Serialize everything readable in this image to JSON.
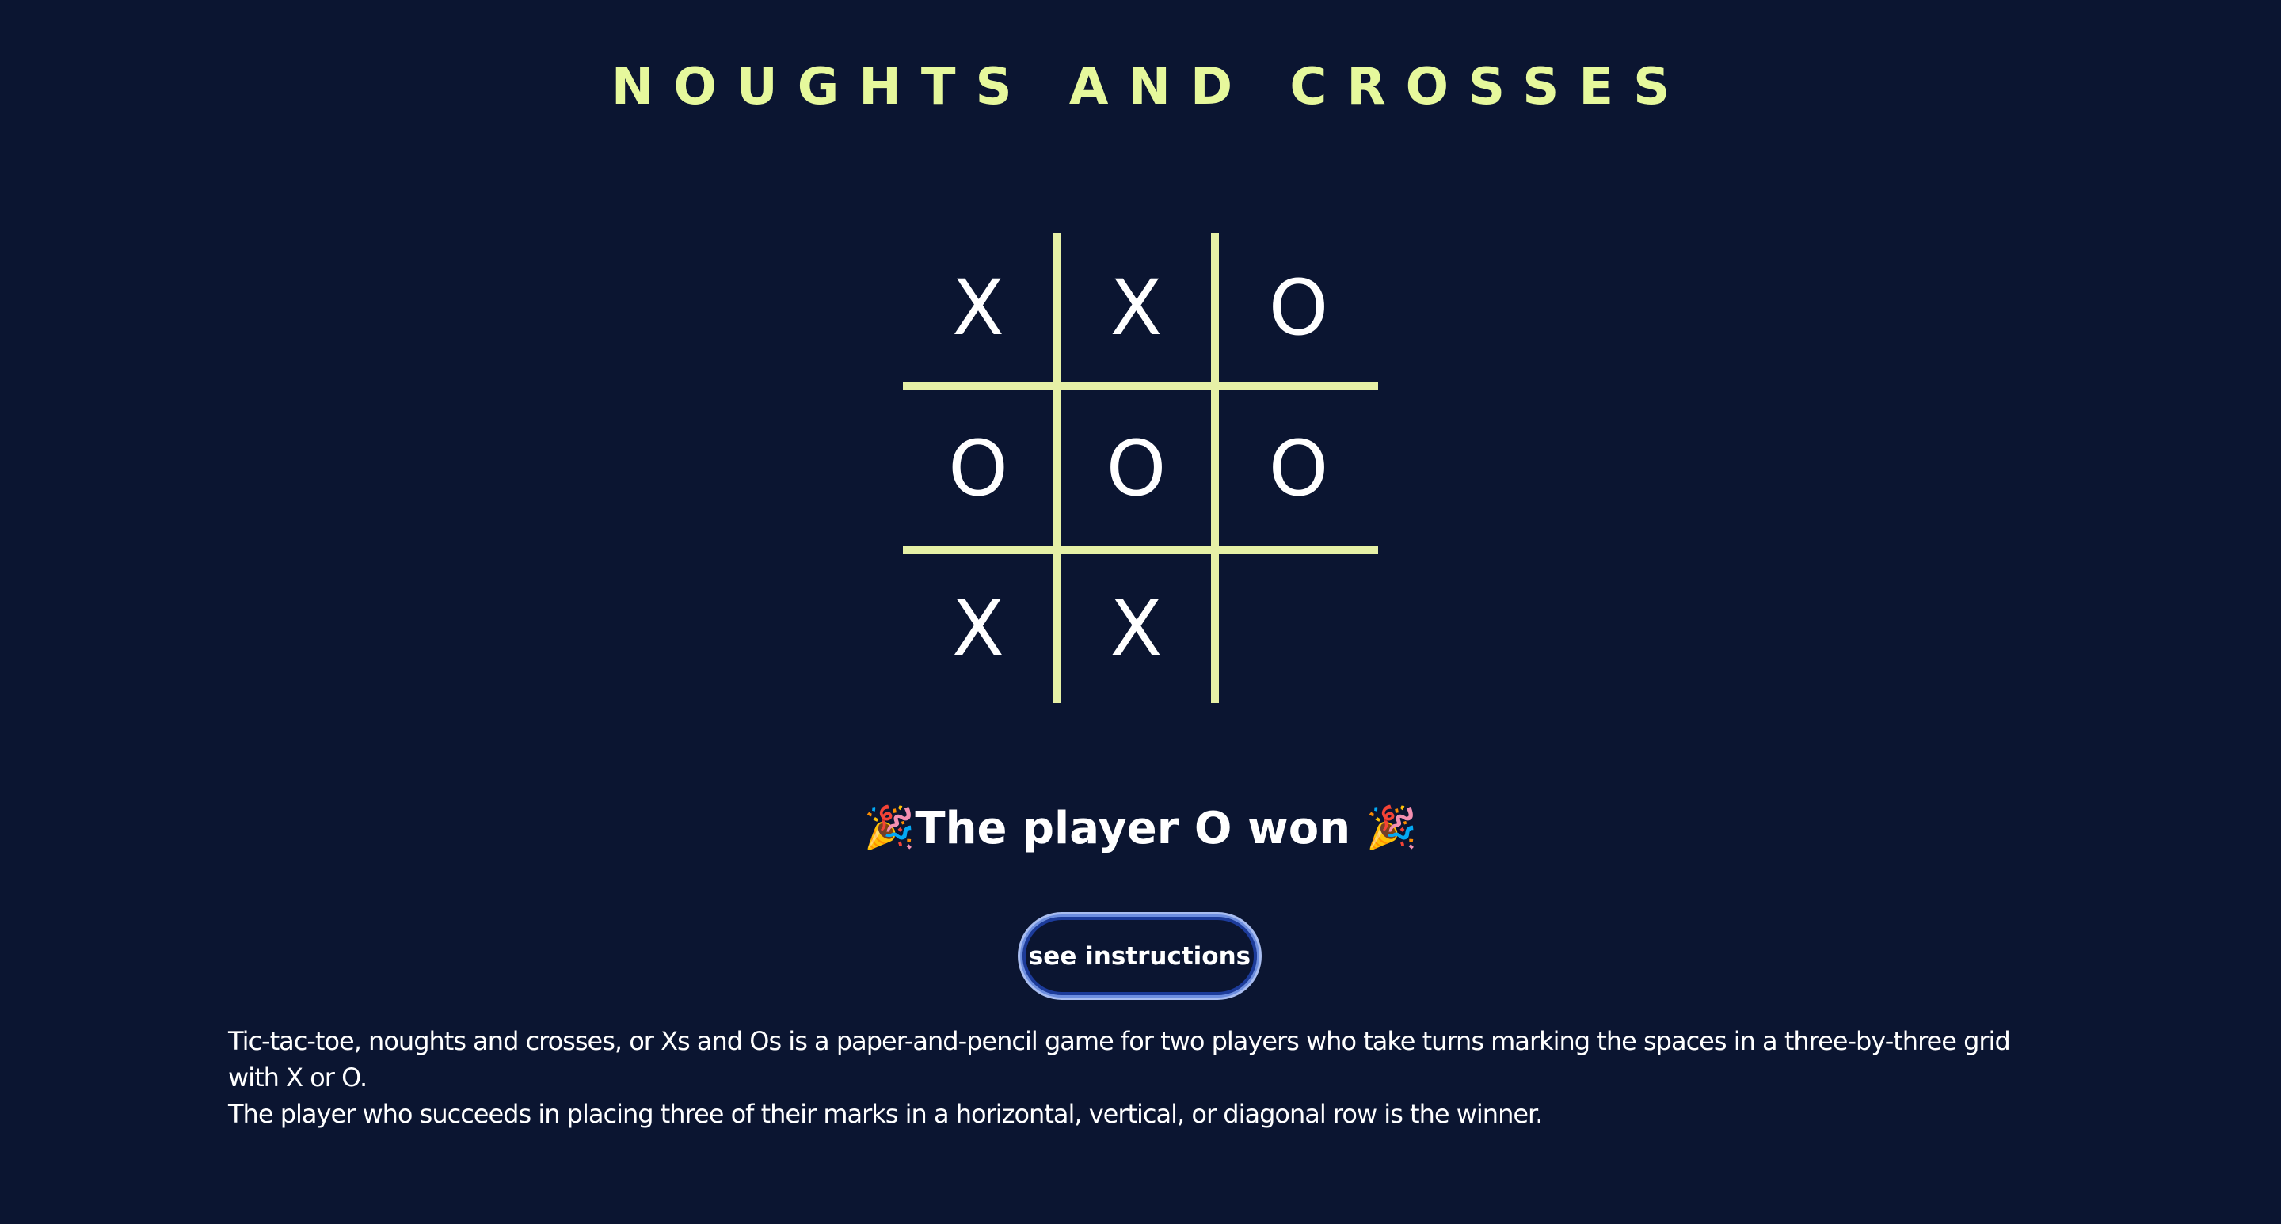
{
  "header": {
    "title": "Noughts and Crosses"
  },
  "board": {
    "cells": [
      "X",
      "X",
      "O",
      "O",
      "O",
      "O",
      "X",
      "X",
      ""
    ]
  },
  "status": {
    "left_emoji": "🎉",
    "text": "The player O won",
    "right_emoji": "🎉"
  },
  "instructions_button": {
    "label": "see instructions"
  },
  "description": {
    "line1": "Tic-tac-toe, noughts and crosses, or Xs and Os is a paper-and-pencil game for two players who take turns marking the spaces in a three-by-three grid with X or O.",
    "line2": "The player who succeeds in placing three of their marks in a horizontal, vertical, or diagonal row is the winner."
  },
  "colors": {
    "background": "#0b1531",
    "accent": "#e6f89c",
    "grid": "#e6f0a6",
    "text": "#ffffff",
    "button_border": "#6d8ee0"
  }
}
